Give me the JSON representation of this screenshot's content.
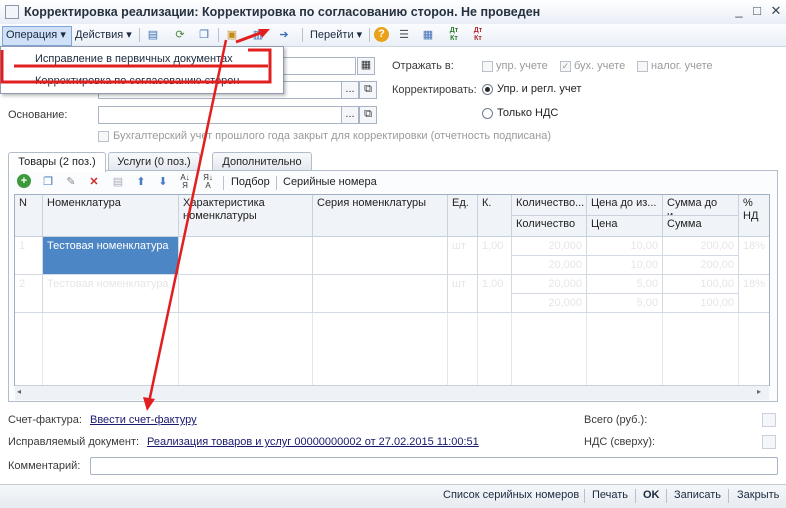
{
  "window": {
    "title": "Корректировка реализации: Корректировка по согласованию сторон. Не проведен"
  },
  "toolbar": {
    "operation": "Операция",
    "actions": "Действия",
    "goto": "Перейти",
    "dt_kt": "Дт Кт"
  },
  "operation_menu": {
    "items": [
      {
        "label": "Исправление в первичных документах"
      },
      {
        "label": "Корректировка по согласованию сторон"
      }
    ]
  },
  "header": {
    "reflect_label": "Отражать в:",
    "reflect_mgmt": "упр. учете",
    "reflect_acc": "бух. учете",
    "reflect_tax": "налог. учете",
    "adjust_label": "Корректировать:",
    "adjust_opt1": "Упр. и регл. учет",
    "adjust_opt2": "Только НДС",
    "basis_label": "Основание:",
    "prev_year_note": "Бухгалтерский учет прошлого года закрыт для корректировки (отчетность подписана)"
  },
  "tabs": [
    {
      "label": "Товары (2 поз.)"
    },
    {
      "label": "Услуги (0 поз.)"
    },
    {
      "label": "Дополнительно"
    }
  ],
  "table_toolbar": {
    "selection": "Подбор",
    "serials": "Серийные номера"
  },
  "table": {
    "headers": {
      "n": "N",
      "nomenclature": "Номенклатура",
      "characteristic": "Характеристика номенклатуры",
      "series": "Серия номенклатуры",
      "unit": "Ед.",
      "k": "К.",
      "qty_before": "Количество...",
      "qty": "Количество",
      "price_before": "Цена до из...",
      "price": "Цена",
      "sum_before": "Сумма до и...",
      "sum": "Сумма",
      "vat": "% НД"
    },
    "rows": [
      {
        "n": "1",
        "nomenclature": "Тестовая номенклатура",
        "unit": "шт",
        "k": "1,00",
        "qty_before": "20,000",
        "qty": "20,000",
        "price_before": "10,00",
        "price": "10,00",
        "sum_before": "200,00",
        "sum": "200,00",
        "vat": "18%"
      },
      {
        "n": "2",
        "nomenclature": "Тестовая номенклатура",
        "unit": "шт",
        "k": "1,00",
        "qty_before": "20,000",
        "qty": "20,000",
        "price_before": "5,00",
        "price": "5,00",
        "sum_before": "100,00",
        "sum": "100,00",
        "vat": "18%"
      }
    ]
  },
  "footer": {
    "invoice_label": "Счет-фактура:",
    "invoice_link": "Ввести счет-фактуру",
    "corrected_label": "Исправляемый документ:",
    "corrected_link": "Реализация товаров и услуг 00000000002 от 27.02.2015 11:00:51",
    "total_label": "Всего (руб.):",
    "vat_label": "НДС (сверху):",
    "comment_label": "Комментарий:"
  },
  "bottom": {
    "serials_list": "Список серийных номеров",
    "print": "Печать",
    "ok": "OK",
    "write": "Записать",
    "close": "Закрыть"
  }
}
